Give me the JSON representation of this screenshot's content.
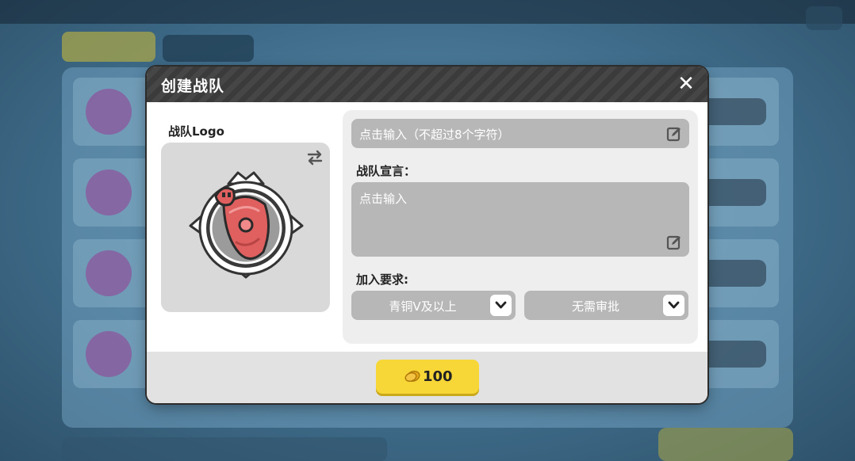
{
  "dialog": {
    "title": "创建战队",
    "close_icon": "close-icon"
  },
  "logo": {
    "label": "战队Logo",
    "swap_icon": "swap-arrows-icon",
    "emblem": "meat-shield-badge"
  },
  "form": {
    "name_placeholder": "点击输入（不超过8个字符）",
    "motto_label": "战队宣言：",
    "motto_placeholder": "点击输入",
    "requirement_label": "加入要求:",
    "rank_value": "青铜V及以上",
    "approval_value": "无需审批",
    "edit_icon": "edit-icon",
    "chevron_icon": "chevron-down-icon"
  },
  "footer": {
    "cost": "100",
    "currency_icon": "gold-coin-icon"
  },
  "colors": {
    "header": "#3b3b3b",
    "input_bg": "#b7b7b7",
    "panel_bg": "#eeeeee",
    "button": "#f6d737",
    "emblem_red": "#e06060"
  }
}
